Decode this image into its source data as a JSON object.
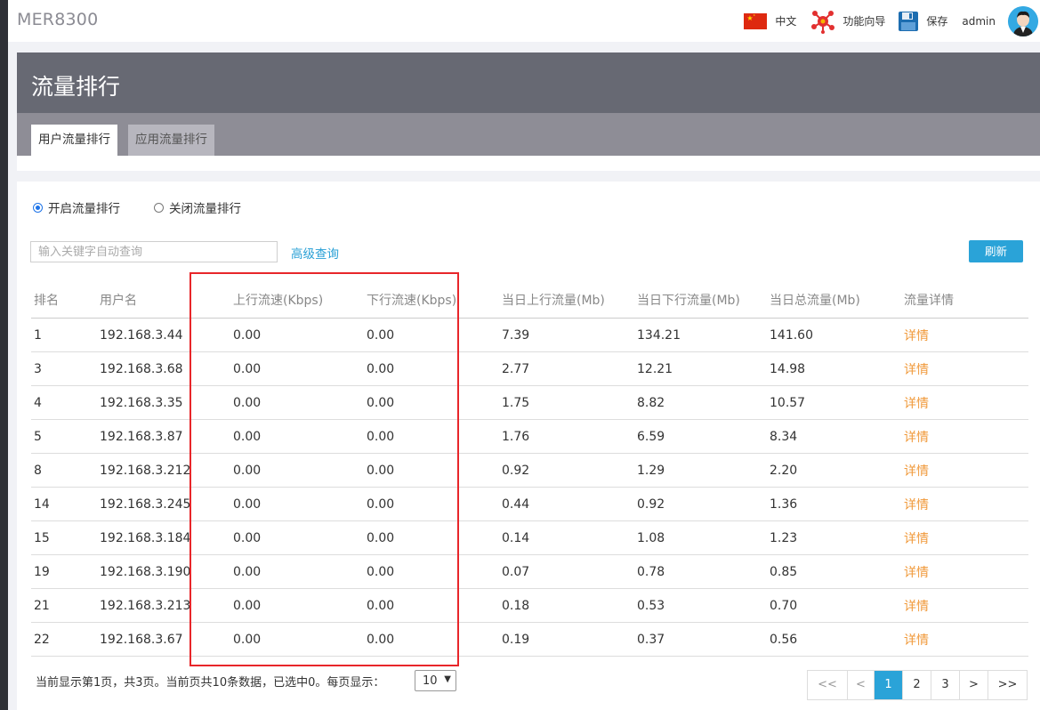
{
  "app": {
    "brand": "MER8300"
  },
  "topbar": {
    "language": "中文",
    "wizard": "功能向导",
    "save": "保存",
    "user": "admin"
  },
  "page": {
    "title": "流量排行",
    "tabs": [
      {
        "label": "用户流量排行",
        "active": true
      },
      {
        "label": "应用流量排行",
        "active": false
      }
    ]
  },
  "controls": {
    "radio_on": "开启流量排行",
    "radio_off": "关闭流量排行",
    "selected": "on",
    "search_placeholder": "输入关键字自动查询",
    "advanced_query": "高级查询",
    "refresh": "刷新"
  },
  "table": {
    "headers": [
      "排名",
      "用户名",
      "上行流速(Kbps)",
      "下行流速(Kbps)",
      "当日上行流量(Mb)",
      "当日下行流量(Mb)",
      "当日总流量(Mb)",
      "流量详情"
    ],
    "rows": [
      [
        "1",
        "192.168.3.44",
        "0.00",
        "0.00",
        "7.39",
        "134.21",
        "141.60",
        "详情"
      ],
      [
        "3",
        "192.168.3.68",
        "0.00",
        "0.00",
        "2.77",
        "12.21",
        "14.98",
        "详情"
      ],
      [
        "4",
        "192.168.3.35",
        "0.00",
        "0.00",
        "1.75",
        "8.82",
        "10.57",
        "详情"
      ],
      [
        "5",
        "192.168.3.87",
        "0.00",
        "0.00",
        "1.76",
        "6.59",
        "8.34",
        "详情"
      ],
      [
        "8",
        "192.168.3.212",
        "0.00",
        "0.00",
        "0.92",
        "1.29",
        "2.20",
        "详情"
      ],
      [
        "14",
        "192.168.3.245",
        "0.00",
        "0.00",
        "0.44",
        "0.92",
        "1.36",
        "详情"
      ],
      [
        "15",
        "192.168.3.184",
        "0.00",
        "0.00",
        "0.14",
        "1.08",
        "1.23",
        "详情"
      ],
      [
        "19",
        "192.168.3.190",
        "0.00",
        "0.00",
        "0.07",
        "0.78",
        "0.85",
        "详情"
      ],
      [
        "21",
        "192.168.3.213",
        "0.00",
        "0.00",
        "0.18",
        "0.53",
        "0.70",
        "详情"
      ],
      [
        "22",
        "192.168.3.67",
        "0.00",
        "0.00",
        "0.19",
        "0.37",
        "0.56",
        "详情"
      ]
    ]
  },
  "footer": {
    "summary": "当前显示第1页，共3页。当前页共10条数据，已选中0。每页显示：",
    "page_size": "10",
    "pager": {
      "first": "<<",
      "prev": "<",
      "pages": [
        "1",
        "2",
        "3"
      ],
      "current": "1",
      "next": ">",
      "last": ">>"
    }
  },
  "colors": {
    "accent": "#2aa3d8",
    "detail_link": "#f0993a",
    "highlight_box": "#e8262a"
  }
}
